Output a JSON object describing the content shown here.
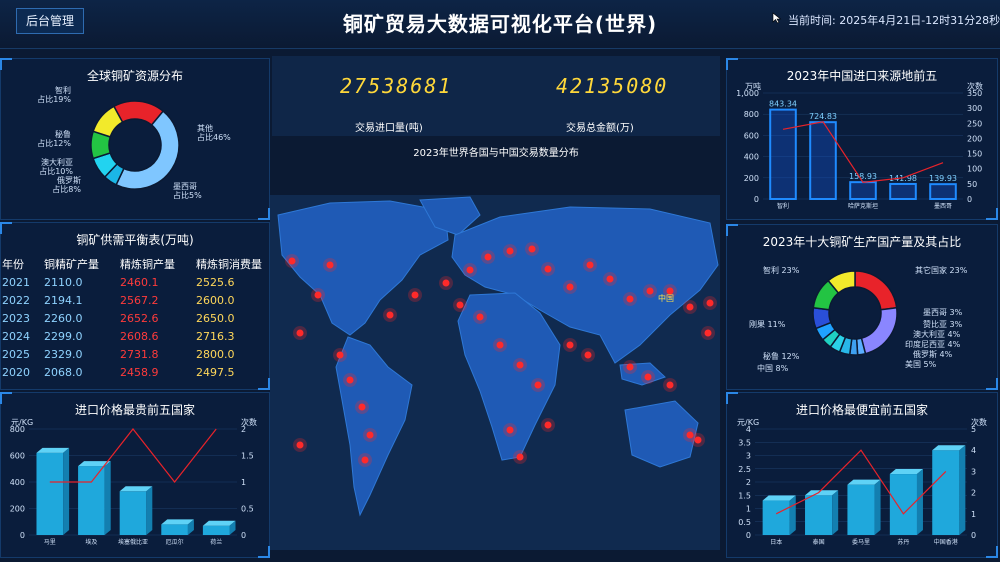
{
  "header": {
    "admin_button": "后台管理",
    "title": "铜矿贸易大数据可视化平台(世界)",
    "time_label": "当前时间:",
    "time_value": "2025年4月21日-12时31分28秒"
  },
  "resource_panel": {
    "title": "全球铜矿资源分布",
    "chart_data": {
      "type": "pie",
      "title": "全球铜矿资源分布",
      "slices": [
        {
          "name": "智利",
          "label": "占比19%",
          "value": 19,
          "color": "#e8232a"
        },
        {
          "name": "其他",
          "label": "占比46%",
          "value": 46,
          "color": "#7fc6ff"
        },
        {
          "name": "墨西哥",
          "label": "占比5%",
          "value": 5,
          "color": "#1bb6e6"
        },
        {
          "name": "俄罗斯",
          "label": "占比8%",
          "value": 8,
          "color": "#22d3f0"
        },
        {
          "name": "澳大利亚",
          "label": "占比10%",
          "value": 10,
          "color": "#23c443"
        },
        {
          "name": "秘鲁",
          "label": "占比12%",
          "value": 12,
          "color": "#f2ea2b"
        }
      ]
    }
  },
  "balance_panel": {
    "title": "铜矿供需平衡表(万吨)",
    "headers": [
      "年份",
      "铜精矿产量",
      "精炼铜产量",
      "精炼铜消费量"
    ],
    "rows": [
      [
        "2021",
        "2110.0",
        "2460.1",
        "2525.6"
      ],
      [
        "2022",
        "2194.1",
        "2567.2",
        "2600.0"
      ],
      [
        "2023",
        "2260.0",
        "2652.6",
        "2650.0"
      ],
      [
        "2024",
        "2299.0",
        "2608.6",
        "2716.3"
      ],
      [
        "2025",
        "2329.0",
        "2731.8",
        "2800.0"
      ],
      [
        "2020",
        "2068.0",
        "2458.9",
        "2497.5"
      ]
    ]
  },
  "expensive_panel": {
    "title": "进口价格最贵前五国家",
    "chart_data": {
      "type": "bar",
      "title": "进口价格最贵前五国家",
      "categories": [
        "马里",
        "埃及",
        "埃塞俄比亚",
        "厄瓜尔",
        "荷兰"
      ],
      "series": [
        {
          "name": "元/KG",
          "values": [
            620,
            520,
            330,
            80,
            70
          ]
        },
        {
          "name": "次数",
          "values": [
            1,
            1,
            2,
            1,
            2
          ]
        }
      ],
      "ylabel": "元/KG",
      "y2label": "次数",
      "ylim": [
        0,
        800
      ],
      "y2lim": [
        0,
        2
      ],
      "yticks": [
        "800",
        "600",
        "400",
        "200",
        "0"
      ],
      "y2ticks": [
        "2",
        "1.5",
        "1",
        "0.5",
        "0"
      ]
    }
  },
  "center": {
    "stat1_value": "27538681",
    "stat1_label": "交易进口量(吨)",
    "stat2_value": "42135080",
    "stat2_label": "交易总金额(万)",
    "map_title": "2023年世界各国与中国交易数量分布",
    "china_label": "中国"
  },
  "import_source_panel": {
    "title": "2023年中国进口来源地前五",
    "chart_data": {
      "type": "bar",
      "title": "2023年中国进口来源地前五",
      "categories": [
        "智利",
        "",
        "哈萨克斯坦",
        "",
        "墨西哥"
      ],
      "series": [
        {
          "name": "万吨",
          "values": [
            843.34,
            724.83,
            158.93,
            141.98,
            139.93
          ]
        },
        {
          "name": "次数",
          "values": [
            230,
            255,
            55,
            70,
            120
          ]
        }
      ],
      "bar_labels": [
        "843.34",
        "724.83",
        "158.93",
        "141.98",
        "139.93"
      ],
      "ylabel": "万吨",
      "y2label": "次数",
      "ylim": [
        0,
        1000
      ],
      "y2lim": [
        0,
        350
      ],
      "yticks": [
        "1,000",
        "800",
        "600",
        "400",
        "200",
        "0"
      ],
      "y2ticks": [
        "350",
        "300",
        "250",
        "200",
        "150",
        "100",
        "50",
        "0"
      ]
    }
  },
  "producer_panel": {
    "title": "2023年十大铜矿生产国产量及其占比",
    "chart_data": {
      "type": "pie",
      "title": "2023年十大铜矿生产国产量及其占比",
      "slices": [
        {
          "name": "智利",
          "label": "23%",
          "value": 23,
          "color": "#e8232a"
        },
        {
          "name": "其它国家",
          "label": "23%",
          "value": 23,
          "color": "#8a86ff"
        },
        {
          "name": "墨西哥",
          "label": "3%",
          "value": 3,
          "color": "#5aaeff"
        },
        {
          "name": "赞比亚",
          "label": "3%",
          "value": 3,
          "color": "#3ea0f0"
        },
        {
          "name": "澳大利亚",
          "label": "4%",
          "value": 4,
          "color": "#28b7e8"
        },
        {
          "name": "印度尼西亚",
          "label": "4%",
          "value": 4,
          "color": "#2ad2e8"
        },
        {
          "name": "俄罗斯",
          "label": "4%",
          "value": 4,
          "color": "#1fd1c2"
        },
        {
          "name": "美国",
          "label": "5%",
          "value": 5,
          "color": "#1fa2ff"
        },
        {
          "name": "中国",
          "label": "8%",
          "value": 8,
          "color": "#2a4fd8"
        },
        {
          "name": "秘鲁",
          "label": "12%",
          "value": 12,
          "color": "#23c443"
        },
        {
          "name": "刚果",
          "label": "11%",
          "value": 11,
          "color": "#f2ea2b"
        }
      ]
    }
  },
  "cheap_panel": {
    "title": "进口价格最便宜前五国家",
    "chart_data": {
      "type": "bar",
      "title": "进口价格最便宜前五国家",
      "categories": [
        "日本",
        "泰国",
        "委马里",
        "苏丹",
        "中国香港"
      ],
      "series": [
        {
          "name": "元/KG",
          "values": [
            1.3,
            1.5,
            1.9,
            2.3,
            3.2
          ]
        },
        {
          "name": "次数",
          "values": [
            1,
            2,
            4,
            1,
            3
          ]
        }
      ],
      "ylabel": "元/KG",
      "y2label": "次数",
      "ylim": [
        0,
        4
      ],
      "y2lim": [
        0,
        5
      ],
      "yticks": [
        "4",
        "3.5",
        "3",
        "2.5",
        "2",
        "1.5",
        "1",
        "0.5",
        "0"
      ],
      "y2ticks": [
        "5",
        "4",
        "3",
        "2",
        "1",
        "0"
      ]
    }
  }
}
